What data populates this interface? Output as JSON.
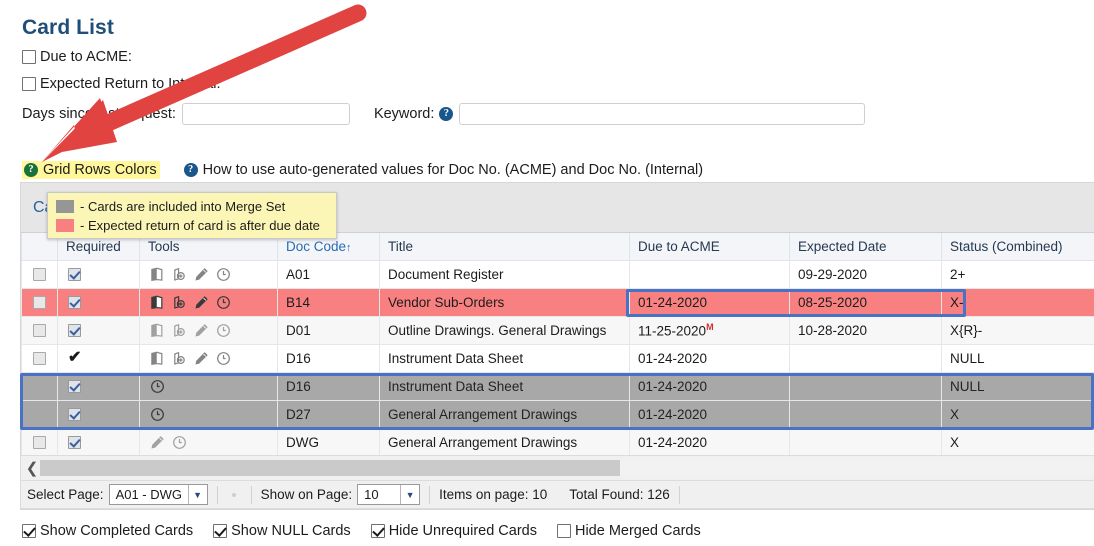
{
  "page": {
    "title": "Card List"
  },
  "filters": {
    "due_to_acme": {
      "label": "Due to ACME:",
      "checked": false
    },
    "expected_return": {
      "label": "Expected Return to Internal:",
      "checked": false
    },
    "days_since_label": "Days since last request:",
    "days_since_value": "",
    "days_since_placeholder": "",
    "keyword_label": "Keyword:",
    "keyword_value": "",
    "keyword_placeholder": ""
  },
  "help_links": [
    {
      "label": "Grid Rows Colors",
      "icon": "help-icon",
      "icon_color": "#18733a",
      "highlighted": true
    },
    {
      "label": "How to use auto-generated values for Doc No. (ACME) and Doc No. (Internal)",
      "icon": "help-icon",
      "icon_color": "#18568c",
      "highlighted": false
    }
  ],
  "tooltip": {
    "lines": [
      {
        "swatch": "#969696",
        "text": "- Cards are included into Merge Set"
      },
      {
        "swatch": "#f98080",
        "text": "- Expected return of card is after due date"
      }
    ]
  },
  "card_panel": {
    "header_title": "Ca"
  },
  "grid": {
    "columns": [
      {
        "key": "sel",
        "label": "",
        "sortable": false
      },
      {
        "key": "req",
        "label": "Required",
        "sortable": false
      },
      {
        "key": "tools",
        "label": "Tools",
        "sortable": false
      },
      {
        "key": "doc",
        "label": "Doc Code",
        "sortable": true,
        "sort_dir": "↑"
      },
      {
        "key": "title",
        "label": "Title",
        "sortable": false
      },
      {
        "key": "due",
        "label": "Due to ACME",
        "sortable": false
      },
      {
        "key": "exp",
        "label": "Expected Date",
        "sortable": false
      },
      {
        "key": "stat",
        "label": "Status (Combined)",
        "sortable": false
      }
    ],
    "rows": [
      {
        "style": "row-white",
        "select_box": "empty",
        "required": "checkbox-checked",
        "tools": [
          "book-icon",
          "add-circle-icon",
          "pencil-icon",
          "clock-icon"
        ],
        "doc_code": "A01",
        "title": "Document Register",
        "due": "",
        "due_sup": "",
        "expected": "09-29-2020",
        "status": "2+"
      },
      {
        "style": "row-pink",
        "select_box": "empty",
        "required": "checkbox-checked",
        "tools": [
          "book-icon",
          "add-circle-icon",
          "pencil-icon",
          "clock-icon"
        ],
        "doc_code": "B14",
        "title": "Vendor Sub-Orders",
        "due": "01-24-2020",
        "due_sup": "",
        "expected": "08-25-2020",
        "status": "X-"
      },
      {
        "style": "row-alt",
        "select_box": "empty",
        "required": "checkbox-checked",
        "tools": [
          "book-icon",
          "add-circle-icon",
          "pencil-icon",
          "clock-icon"
        ],
        "doc_code": "D01",
        "title": "Outline Drawings. General Drawings",
        "due": "11-25-2020",
        "due_sup": "M",
        "expected": "10-28-2020",
        "status": "X{R}-"
      },
      {
        "style": "row-white",
        "select_box": "empty",
        "required": "bold-check",
        "tools": [
          "book-icon",
          "add-circle-icon",
          "pencil-icon",
          "clock-icon"
        ],
        "doc_code": "D16",
        "title": "Instrument Data Sheet",
        "due": "01-24-2020",
        "due_sup": "",
        "expected": "",
        "status": "NULL"
      },
      {
        "style": "row-gray",
        "select_box": "none",
        "required": "checkbox-checked",
        "tools": [
          "clock-icon"
        ],
        "doc_code": "D16",
        "title": "Instrument Data Sheet",
        "due": "01-24-2020",
        "due_sup": "",
        "expected": "",
        "status": "NULL"
      },
      {
        "style": "row-gray",
        "select_box": "none",
        "required": "checkbox-checked",
        "tools": [
          "clock-icon"
        ],
        "doc_code": "D27",
        "title": "General Arrangement Drawings",
        "due": "01-24-2020",
        "due_sup": "",
        "expected": "",
        "status": "X"
      },
      {
        "style": "row-alt",
        "select_box": "empty",
        "required": "checkbox-checked",
        "tools": [
          "pencil-icon",
          "clock-icon"
        ],
        "doc_code": "DWG",
        "title": "General Arrangement Drawings",
        "due": "01-24-2020",
        "due_sup": "",
        "expected": "",
        "status": "X"
      }
    ]
  },
  "pager": {
    "select_page_label": "Select Page:",
    "select_page_value": "A01 - DWG",
    "show_on_page_label": "Show on Page:",
    "show_on_page_value": "10",
    "items_on_page": "Items on page: 10",
    "total_found": "Total Found: 126"
  },
  "bottom_options": [
    {
      "label": "Show Completed Cards",
      "checked": true
    },
    {
      "label": "Show NULL Cards",
      "checked": true
    },
    {
      "label": "Hide Unrequired Cards",
      "checked": true
    },
    {
      "label": "Hide Merged Cards",
      "checked": false
    }
  ],
  "annotations": {
    "arrow_color": "#e04340",
    "highlight_box_color": "#4a72c4"
  }
}
